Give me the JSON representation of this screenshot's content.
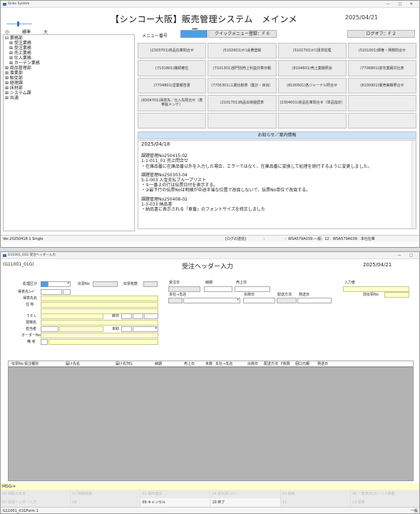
{
  "win1": {
    "titlebar": "Sinko System",
    "title": "【シンコー大阪】販売管理システム　メインメニュー",
    "date": "2025/04/21",
    "zoom": {
      "small": "小",
      "standard": "標準",
      "large": "大"
    },
    "menu_no_label": "メニュー番号",
    "quick_btn": "クイックメニュー登録：Ｆ６",
    "logoff_btn": "ログオフ：Ｆ２",
    "tree": [
      {
        "t": "⊟ 業務部",
        "c": false
      },
      {
        "t": "⊞ 受注業務",
        "c": true
      },
      {
        "t": "⊞ 受注業務",
        "c": true
      },
      {
        "t": "⊞ 売上業務",
        "c": true
      },
      {
        "t": "⊞ 仕入業務",
        "c": true
      },
      {
        "t": "⊞ カーテン業務",
        "c": true
      },
      {
        "t": "⊞ 商品管理部",
        "c": false
      },
      {
        "t": "⊞ 事業部",
        "c": false
      },
      {
        "t": "⊞ 販促部",
        "c": false
      },
      {
        "t": "⊞ 経理課",
        "c": false
      },
      {
        "t": "⊞ 床材部",
        "c": false
      },
      {
        "t": "⊞ システム課",
        "c": false
      },
      {
        "t": "⊞ 共通",
        "c": false
      }
    ],
    "buttons": [
      "(2303701)商品在庫問合せ",
      "(5102601)ｵﾘｺ会費登録",
      "(5102701)ｵﾘｺ請求処理",
      "(5101001)債権・債務問合せ",
      "(7101801)棚卸確位",
      "(7101301)部門別売上利益計算日報",
      "(8104601)売上業績照会",
      "(7706801)前年業績対比表",
      "(7704801)営業報告書",
      "(7705301)三期比較表（集計・目出）",
      "(8100501)各ジャーナル照合せ",
      "(8100901)販売実績照合せ",
      "(8304701)得意先／仕入先照合せ（携帯版メンテ）",
      "(2101701)商品出荷履歴表",
      "(2304001)商品在庫問合せ（単品指定）",
      "",
      "",
      "",
      "",
      ""
    ],
    "news_header": "お知らせ／案内情報",
    "news": [
      {
        "type": "date",
        "t": "2025/04/18"
      },
      {
        "type": "blank",
        "t": ""
      },
      {
        "type": "line",
        "t": "課題管理No250415-02"
      },
      {
        "type": "line",
        "t": "1-1-011_01 売上問合せ"
      },
      {
        "type": "line",
        "t": "・在庫品番に在庫品番以外を入力した場合、エラーではなく、在庫品番に変換して処理を続行するように変更しました。"
      },
      {
        "type": "blank",
        "t": ""
      },
      {
        "type": "line",
        "t": "課題管理No250303-04"
      },
      {
        "type": "line",
        "t": "5-1-003 入金支払ブループリスト"
      },
      {
        "type": "line",
        "t": "・①一番上の行は伝票日付を表示する。"
      },
      {
        "type": "line",
        "t": "・②最下行の伝票Noは明細が中途半端な位置で改頁しないで、伝票No単位で改頁する。"
      },
      {
        "type": "blank",
        "t": ""
      },
      {
        "type": "line",
        "t": "課題管理No250408-02"
      },
      {
        "type": "line",
        "t": "1-3-033 納品書"
      },
      {
        "type": "line",
        "t": "・納品書に表示される「車番」のフォントサイズを修正しました"
      }
    ],
    "status": {
      "ver": "Ver.20250418  1  Single",
      "logstate": "[ログの送信]",
      "sep": "：",
      "server": "：WSA579A039:---般：12：WSA579A039：本社在庫"
    }
  },
  "win2": {
    "titlebar": "G11001_01G 受注ヘッダー入力",
    "form_id": "(G11001_01G)",
    "title": "受注ヘッダー入力",
    "date": "2025/04/21",
    "labels": {
      "shori": "処理区分",
      "denno": "伝票No",
      "denmaisu": "伝票枚数",
      "juchubi": "受注日",
      "nouki": "納期",
      "uriagebi": "売上日",
      "nyuryokusha": "入力者",
      "tokuisaki_code": "得意先ｺｰﾄﾞ",
      "tokuisaki_name": "得意先名",
      "honsha": "本社→支店",
      "shukkabi": "出荷日",
      "haisou": "配送方法",
      "hasoubi": "発送日",
      "zen_denno": "前伝票No",
      "address": "住  所",
      "tel": "ＴＥＬ",
      "shimebi": "締日",
      "genbamei": "現場名",
      "tantosha": "担当者",
      "kaishu": "未助",
      "order_no": "オーダーNo",
      "biko": "備  考"
    },
    "columns": [
      "伝票No",
      "受注種別",
      "届け先名",
      "届け先TEL",
      "納期",
      "売上日",
      "未数",
      "本社→支店",
      "出荷日",
      "配送方法",
      "F枚数",
      "個口",
      "元親",
      "発送日"
    ],
    "msg": "MSG⇒",
    "fkeys": [
      {
        "t": "01 相殺日未定",
        "on": false
      },
      {
        "t": "02 明細検索",
        "on": false
      },
      {
        "t": "03 最終確認",
        "on": false
      },
      {
        "t": "04 前伝票コピー",
        "on": false
      },
      {
        "t": "05 検索",
        "on": false
      },
      {
        "t": "06 一覧表示(カーソル移動",
        "on": false
      },
      {
        "t": "07 伝票ヘッダー入力",
        "on": false
      },
      {
        "t": "08",
        "on": false
      },
      {
        "t": "09 キャンセル",
        "on": true
      },
      {
        "t": "10 終了",
        "on": true
      },
      {
        "t": "11",
        "on": false
      },
      {
        "t": "12 更新",
        "on": false
      }
    ],
    "status": {
      "left": "G11001_01GForm  1",
      "right": "一般"
    }
  },
  "colors": {
    "accent": "#4aa0e6",
    "input_yellow": "#ffffcc",
    "grid_gray": "#b3b3b3",
    "news_header": "#cfe2f3"
  }
}
